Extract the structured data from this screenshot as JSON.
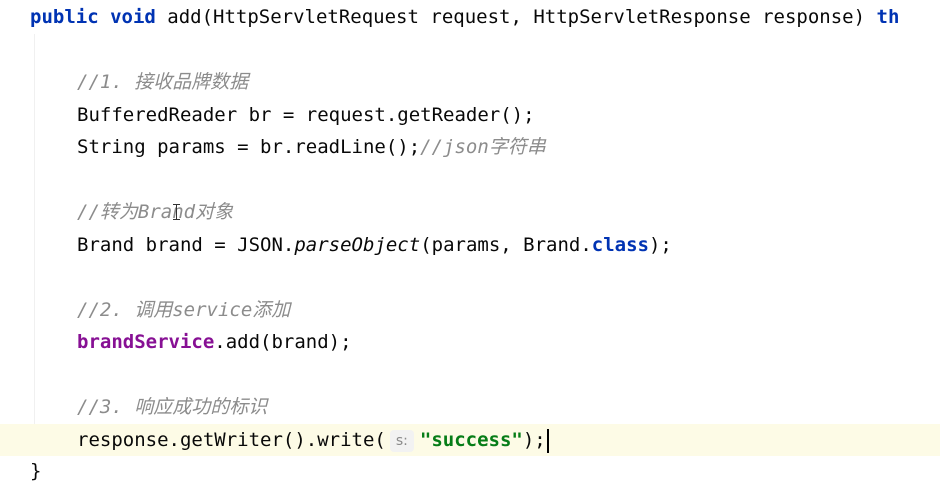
{
  "code": {
    "l1_mod": "public void",
    "l1_rest": " add(HttpServletRequest request, HttpServletResponse response) ",
    "l1_tail": "th",
    "c1": "//1. 接收品牌数据",
    "l2": "BufferedReader br = request.getReader();",
    "l3_code": "String params = br.readLine();",
    "l3_cm": "//json字符串",
    "c2": "//转为Brand对象",
    "l4_a": "Brand brand = JSON.",
    "l4_m": "parseObject",
    "l4_b": "(params, Brand.",
    "l4_kw": "class",
    "l4_c": ");",
    "c3": "//2. 调用service添加",
    "l5_f": "brandService",
    "l5_b": ".add(brand);",
    "c4": "//3. 响应成功的标识",
    "l6_a": "response.getWriter().write(",
    "l6_hint": "s:",
    "l6_str": "\"success\"",
    "l6_b": ");",
    "close": "}"
  }
}
